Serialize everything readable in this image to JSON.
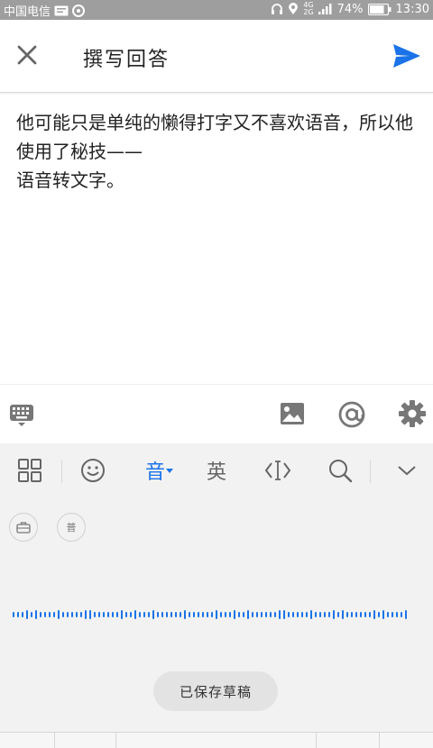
{
  "status_bar": {
    "carrier": "中国电信",
    "network": "4G",
    "signal_label": "2G",
    "battery": "74%",
    "time": "13:30"
  },
  "header": {
    "title": "撰写回答",
    "close_icon": "close-icon",
    "send_icon": "send-icon"
  },
  "editor": {
    "paragraph1": "他可能只是单纯的懒得打字又不喜欢语音，所以他使用了秘技——",
    "paragraph2": "语音转文字。"
  },
  "toolbar": {
    "icons": [
      "keyboard-icon",
      "image-icon",
      "at-icon",
      "gear-icon"
    ]
  },
  "ime": {
    "voice_tab": "音",
    "english_tab": "英",
    "chip_putong": "普",
    "toast": "已保存草稿",
    "accent": "#1a73e8"
  }
}
